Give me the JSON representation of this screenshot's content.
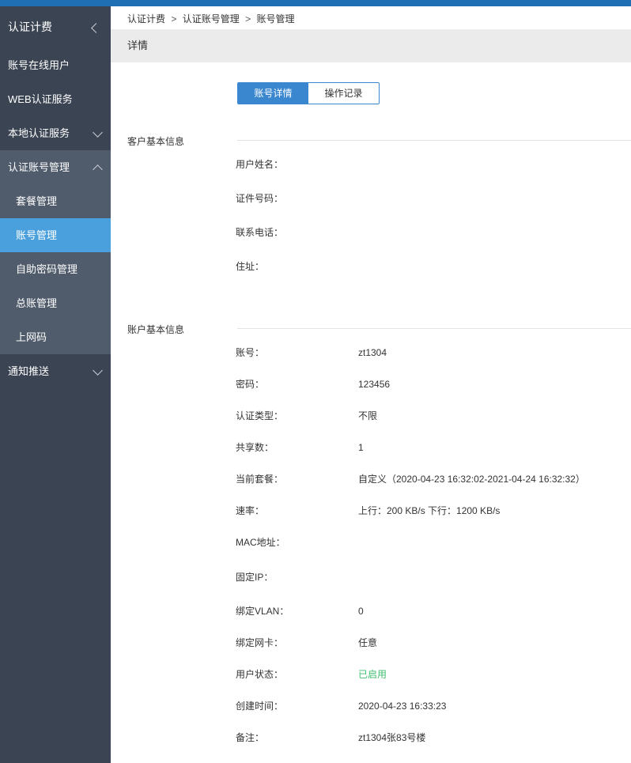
{
  "sidebar": {
    "header": "认证计费",
    "items": [
      {
        "label": "账号在线用户"
      },
      {
        "label": "WEB认证服务"
      },
      {
        "label": "本地认证服务"
      },
      {
        "label": "认证账号管理"
      },
      {
        "label": "套餐管理"
      },
      {
        "label": "账号管理"
      },
      {
        "label": "自助密码管理"
      },
      {
        "label": "总账管理"
      },
      {
        "label": "上网码"
      },
      {
        "label": "通知推送"
      }
    ]
  },
  "breadcrumb": {
    "items": [
      "认证计费",
      "认证账号管理",
      "账号管理"
    ],
    "separator": ">"
  },
  "page_title": "详情",
  "tabs": [
    {
      "label": "账号详情",
      "active": true
    },
    {
      "label": "操作记录",
      "active": false
    }
  ],
  "customer_section": {
    "title": "客户基本信息",
    "fields": [
      {
        "label": "用户姓名：",
        "value": ""
      },
      {
        "label": "证件号码：",
        "value": ""
      },
      {
        "label": "联系电话：",
        "value": ""
      },
      {
        "label": "住址：",
        "value": ""
      }
    ]
  },
  "account_section": {
    "title": "账户基本信息",
    "fields": [
      {
        "label": "账号：",
        "value": "zt1304"
      },
      {
        "label": "密码：",
        "value": "123456"
      },
      {
        "label": "认证类型：",
        "value": "不限"
      },
      {
        "label": "共享数：",
        "value": "1"
      },
      {
        "label": "当前套餐：",
        "value": "自定义（2020-04-23 16:32:02-2021-04-24 16:32:32）"
      },
      {
        "label": "速率：",
        "value": "上行：200 KB/s 下行：1200 KB/s"
      },
      {
        "label": "MAC地址：",
        "value": ""
      },
      {
        "label": "固定IP：",
        "value": ""
      },
      {
        "label": "绑定VLAN：",
        "value": "0"
      },
      {
        "label": "绑定网卡：",
        "value": "任意"
      },
      {
        "label": "用户状态：",
        "value": "已启用"
      },
      {
        "label": "创建时间：",
        "value": "2020-04-23 16:33:23"
      },
      {
        "label": "备注：",
        "value": "zt1304张83号楼"
      }
    ]
  },
  "colors": {
    "sidebar_bg": "#3b4452",
    "sidebar_sub_bg": "#505b6b",
    "sidebar_active": "#4aa0dc",
    "accent": "#3a87d0",
    "status_green": "#3fbf6e"
  }
}
